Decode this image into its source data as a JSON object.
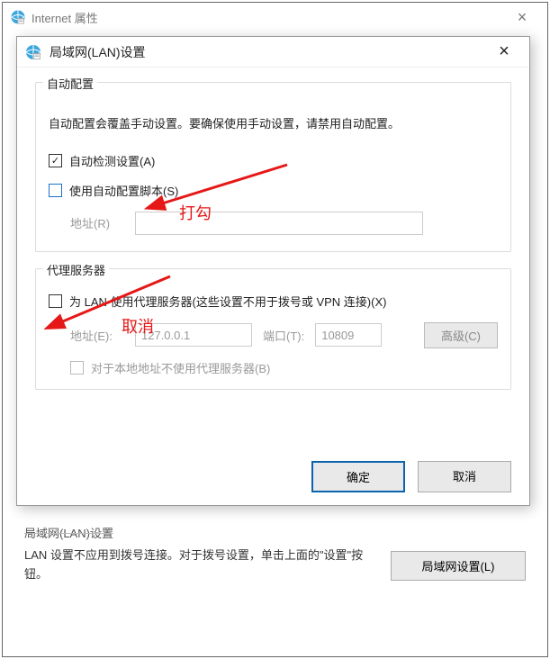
{
  "parent": {
    "title": "Internet 属性"
  },
  "dialog": {
    "title": "局域网(LAN)设置",
    "auto_config": {
      "legend": "自动配置",
      "desc": "自动配置会覆盖手动设置。要确保使用手动设置，请禁用自动配置。",
      "auto_detect_label": "自动检测设置(A)",
      "auto_detect_checked": true,
      "use_script_label": "使用自动配置脚本(S)",
      "use_script_checked": false,
      "address_label": "地址(R)",
      "address_value": ""
    },
    "proxy": {
      "legend": "代理服务器",
      "use_proxy_label": "为 LAN 使用代理服务器(这些设置不用于拨号或 VPN 连接)(X)",
      "use_proxy_checked": false,
      "address_label": "地址(E):",
      "address_value": "127.0.0.1",
      "port_label": "端口(T):",
      "port_value": "10809",
      "advanced_label": "高级(C)",
      "bypass_local_label": "对于本地地址不使用代理服务器(B)"
    },
    "ok_label": "确定",
    "cancel_label": "取消"
  },
  "lan_bottom": {
    "section_title": "局域网(LAN)设置",
    "desc": "LAN 设置不应用到拨号连接。对于拨号设置，单击上面的\"设置\"按钮。",
    "button_label": "局域网设置(L)"
  },
  "annotations": {
    "check": "打勾",
    "uncheck": "取消"
  }
}
